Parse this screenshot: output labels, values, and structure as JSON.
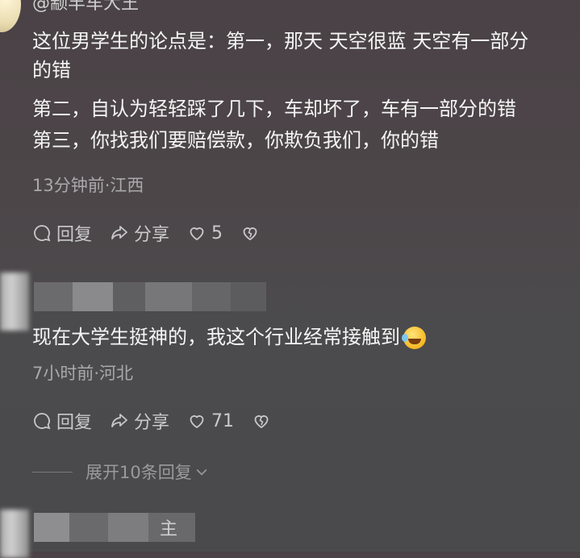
{
  "comment1": {
    "username": "@颛丰车大王",
    "text_lines": [
      "这位男学生的论点是：第一，那天 天空很蓝 天空有一部分",
      "的错",
      "第二，自认为轻轻踩了几下，车却坏了，车有一部分的错",
      "第三，你找我们要赔偿款，你欺负我们，你的错"
    ],
    "meta": "13分钟前·江西",
    "reply_label": "回复",
    "share_label": "分享",
    "like_count": "5"
  },
  "comment2": {
    "text": "现在大学生挺神的，我这个行业经常接触到",
    "emoji": "rofl-emoji",
    "meta": "7小时前·河北",
    "reply_label": "回复",
    "share_label": "分享",
    "like_count": "71",
    "expand_label": "展开10条回复"
  },
  "comment3": {
    "name_tail": "主"
  },
  "colors": {
    "text": "#f5f5f5",
    "meta": "#a9a9ab",
    "action": "#c9c9cb"
  }
}
